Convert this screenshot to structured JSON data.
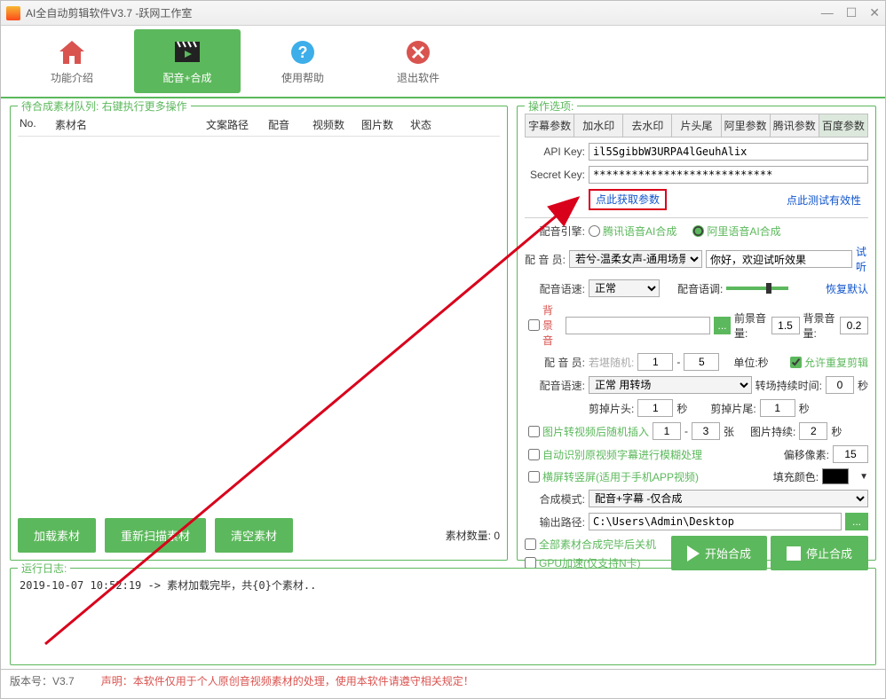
{
  "window": {
    "title": "AI全自动剪辑软件V3.7 -跃网工作室"
  },
  "toolbar": {
    "intro": "功能介绍",
    "compose": "配音+合成",
    "help": "使用帮助",
    "exit": "退出软件"
  },
  "left": {
    "legend": "待合成素材队列: 右键执行更多操作",
    "headers": {
      "no": "No.",
      "name": "素材名",
      "path": "文案路径",
      "voice": "配音",
      "vids": "视频数",
      "pics": "图片数",
      "status": "状态"
    },
    "btn_load": "加载素材",
    "btn_rescan": "重新扫描素材",
    "btn_clear": "清空素材",
    "count": "素材数量: 0"
  },
  "right": {
    "legend": "操作选项:",
    "tabs": {
      "subtitle": "字幕参数",
      "watermark": "加水印",
      "dewatermark": "去水印",
      "headtail": "片头尾",
      "ali": "阿里参数",
      "tencent": "腾讯参数",
      "baidu": "百度参数"
    },
    "api_key_label": "API Key:",
    "api_key": "il5SgibbW3URPA4lGeuhAlix",
    "secret_key_label": "Secret Key:",
    "secret_key": "****************************",
    "get_params": "点此获取参数",
    "test_valid": "点此测试有效性",
    "engine_label": "配音引擎:",
    "engine_tencent": "腾讯语音AI合成",
    "engine_ali": "阿里语音AI合成",
    "voice_label": "配 音 员:",
    "voice_option": "若兮-温柔女声-通用场景",
    "welcome": "你好，欢迎试听效果",
    "try_listen": "试听",
    "speed_label": "配音语速:",
    "speed_option": "正常",
    "tone_label": "配音语调:",
    "restore_default": "恢复默认",
    "bgm_label": "背景音",
    "fg_vol_label": "前景音量:",
    "fg_vol": "1.5",
    "bg_vol_label": "背景音量:",
    "bg_vol": "0.2",
    "voice_count_label": "配 音 员:",
    "random_voice": "若堪随机:",
    "rand_from": "1",
    "rand_to": "5",
    "unit_sec": "单位:秒",
    "allow_rep": "允许重复剪辑",
    "speed_label2": "配音语速:",
    "speed_opt2": "正常  用转场",
    "trans_dur_label": "转场持续时间:",
    "trans_dur": "0",
    "sec": "秒",
    "trim_head_label": "剪掉片头:",
    "trim_head": "1",
    "trim_tail_label": "剪掉片尾:",
    "trim_tail": "1",
    "pic2vid_label": "图片转视频后随机插入",
    "p_from": "1",
    "p_to": "3",
    "zhang": "张",
    "pic_dur_label": "图片持续:",
    "pic_dur": "2",
    "auto_blur": "自动识别原视频字幕进行模糊处理",
    "offset_label": "偏移像素:",
    "offset": "15",
    "h2v_label": "横屏转竖屏(适用于手机APP视频)",
    "fill_color_label": "填充颜色:",
    "mode_label": "合成模式:",
    "mode_option": "配音+字幕 -仅合成",
    "out_label": "输出路径:",
    "out_path": "C:\\Users\\Admin\\Desktop",
    "shutdown": "全部素材合成完毕后关机",
    "gpu": "GPU加速(仅支持N卡)",
    "start": "开始合成",
    "stop": "停止合成"
  },
  "log": {
    "legend": "运行日志:",
    "line": "2019-10-07 10:52:19 -> 素材加载完毕，共{0}个素材.."
  },
  "footer": {
    "version": "版本号：V3.7",
    "notice": "声明：本软件仅用于个人原创音视频素材的处理，使用本软件请遵守相关规定！"
  }
}
